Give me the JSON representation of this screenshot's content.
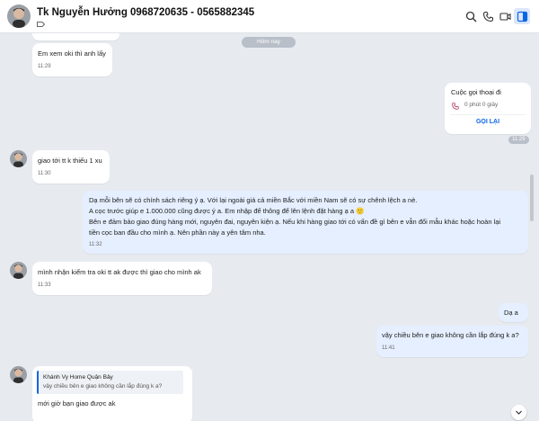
{
  "header": {
    "contact_name": "Tk Nguyễn Hưởng 0968720635 - 0565882345",
    "icons": [
      "search-icon",
      "phone-icon",
      "video-icon",
      "sidebar-toggle-icon"
    ],
    "accent": "#0b66e4"
  },
  "chat": {
    "date_divider": "Hôm nay",
    "messages": [
      {
        "text": "Em xem oki thì anh lấy",
        "time": "11:29"
      },
      {
        "text": "giao tới tt k thiếu 1 xu",
        "time": "11:30"
      },
      {
        "lines": [
          "Dạ mỗi bên sẽ có chính sách riêng ý ạ. Với lại ngoài giá cả miền Bắc với miền Nam sẽ có sự chênh lệch a nè.",
          "A cọc trước giúp e 1.000.000 cũng được ý a. Em nhập để thông để lên lệnh đặt hàng ạ a 🙂",
          "Bên e đảm bảo giao đúng hàng mới, nguyên đai, nguyên kiện ạ. Nếu khi hàng giao tới có vấn đề gì bên e vẫn đổi mẫu khác hoặc hoàn lại",
          "tiền cọc ban đầu cho mình ạ. Nên phần này a yên tâm nha."
        ],
        "time": "11:32"
      },
      {
        "text": "mình nhận kiểm tra oki tt ak được thì giao cho mình ak",
        "time": "11:33"
      },
      {
        "text": "Dạ a"
      },
      {
        "text": "vậy chiều bên e giao không cần lắp đúng k a?",
        "time": "11:41"
      },
      {
        "quote_name": "Khánh Vy Home Quận Bảy",
        "quote_text": "vậy chiều bên e giao không cần lắp đúng k a?",
        "text": "mới giờ bạn giao được ak"
      }
    ],
    "call_card": {
      "title": "Cuộc gọi thoại đi",
      "duration": "0 phút 0 giây",
      "action": "GỌI LẠI",
      "time": "11:29"
    }
  }
}
